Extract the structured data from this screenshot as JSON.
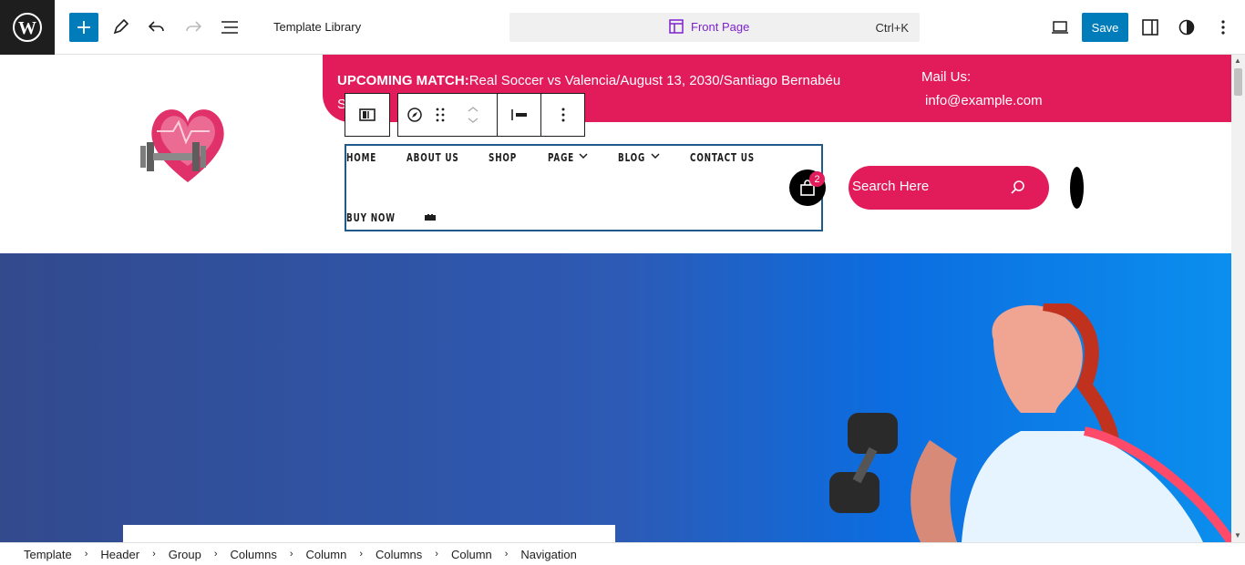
{
  "toolbar": {
    "template_library": "Template Library",
    "page_title": "Front Page",
    "shortcut": "Ctrl+K",
    "save_label": "Save"
  },
  "topbar_band": {
    "match_label": "UPCOMING MATCH:",
    "match_text": "Real Soccer vs Valencia/August 13, 2030/Santiago Bernabéu",
    "match_overflow": "S",
    "mail_label": "Mail Us:",
    "mail_value": "info@example.com"
  },
  "nav": {
    "items": [
      "HOME",
      "ABOUT US",
      "SHOP",
      "PAGE",
      "BLOG",
      "CONTACT US",
      "BUY NOW"
    ]
  },
  "cart": {
    "count": "2"
  },
  "search": {
    "placeholder": "Search Here"
  },
  "breadcrumb": [
    "Template",
    "Header",
    "Group",
    "Columns",
    "Column",
    "Columns",
    "Column",
    "Navigation"
  ],
  "colors": {
    "accent": "#e21b5a",
    "wp_blue": "#007cba",
    "cmd_purple": "#7e22ce"
  }
}
